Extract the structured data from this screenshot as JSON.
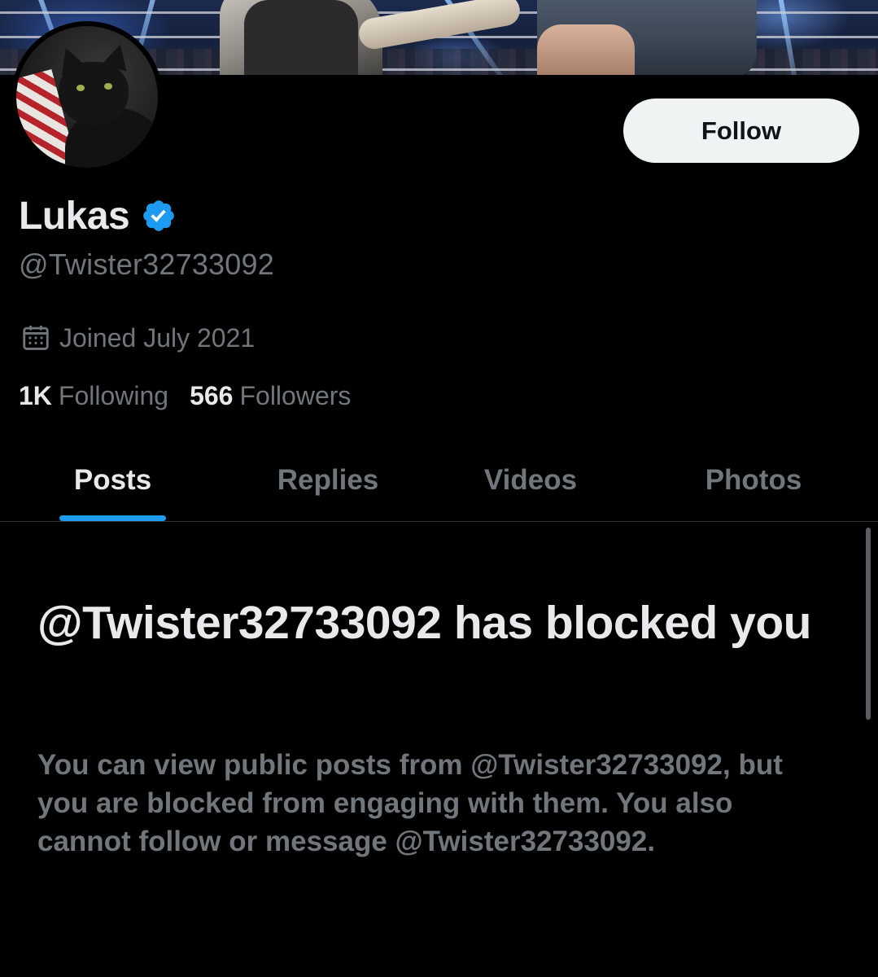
{
  "profile": {
    "display_name": "Lukas",
    "handle": "@Twister32733092",
    "verified": true,
    "joined": "Joined July 2021",
    "following_count": "1K",
    "following_label": "Following",
    "followers_count": "566",
    "followers_label": "Followers"
  },
  "actions": {
    "follow_label": "Follow"
  },
  "tabs": [
    {
      "label": "Posts",
      "active": true
    },
    {
      "label": "Replies",
      "active": false
    },
    {
      "label": "Videos",
      "active": false
    },
    {
      "label": "Photos",
      "active": false
    }
  ],
  "blocked_notice": {
    "title": "@Twister32733092 has blocked you",
    "description": "You can view public posts from @Twister32733092, but you are blocked from engaging with them. You also cannot follow or message @Twister32733092."
  },
  "colors": {
    "background": "#000000",
    "primary_text": "#e7e9ea",
    "secondary_text": "#71767b",
    "accent": "#1d9bf0",
    "follow_button_bg": "#eff3f4"
  },
  "icons": {
    "verified": "verified-badge-icon",
    "calendar": "calendar-icon"
  }
}
